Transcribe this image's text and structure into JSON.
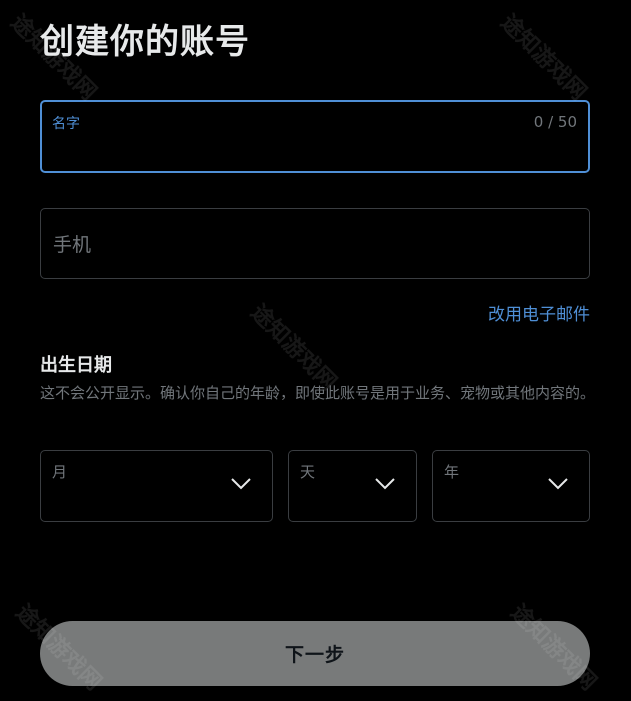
{
  "page": {
    "title": "创建你的账号"
  },
  "name_field": {
    "label": "名字",
    "counter": "0 / 50",
    "value": ""
  },
  "phone_field": {
    "placeholder": "手机"
  },
  "email_link": "改用电子邮件",
  "dob": {
    "heading": "出生日期",
    "description": "这不会公开显示。确认你自己的年龄，即使此账号是用于业务、宠物或其他内容的。",
    "month_label": "月",
    "day_label": "天",
    "year_label": "年"
  },
  "next_button": "下一步",
  "watermark": "途知游戏网",
  "colors": {
    "accent": "#4f8fd6",
    "background": "#000000",
    "muted": "#71767b",
    "button_bg": "#787a7a"
  }
}
